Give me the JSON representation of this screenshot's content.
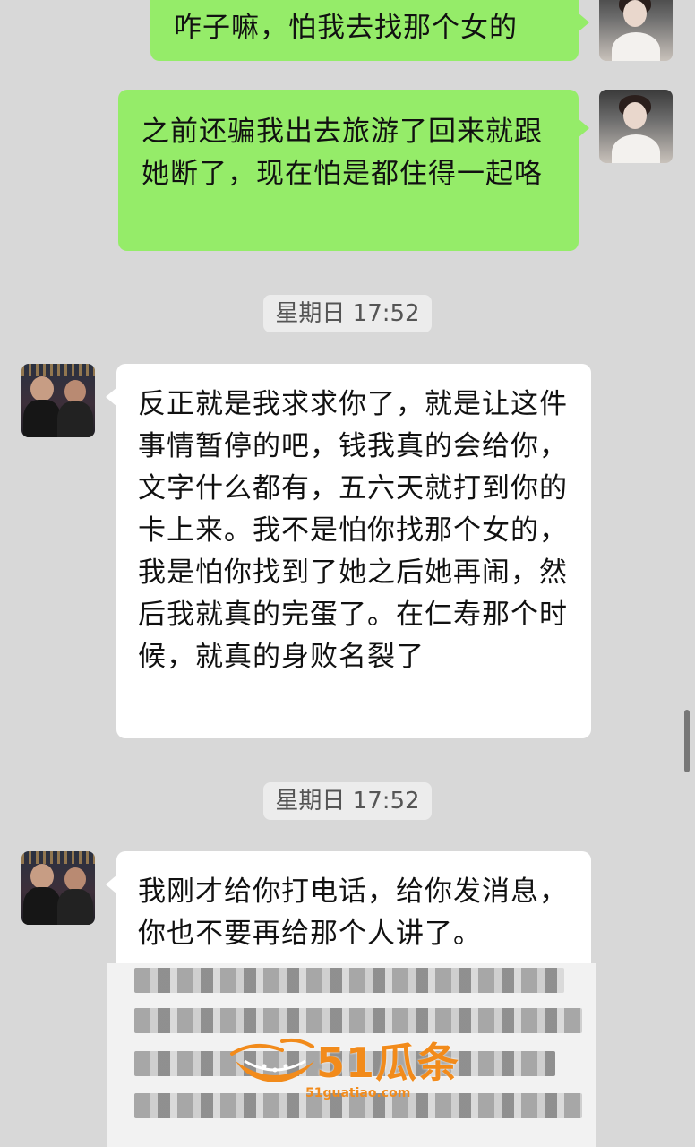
{
  "messages": [
    {
      "side": "out",
      "text": "咋子嘛，怕我去找那个女的"
    },
    {
      "side": "out",
      "text": "之前还骗我出去旅游了回来就跟她断了，现在怕是都住得一起咯"
    },
    {
      "type": "time",
      "text": "星期日 17:52"
    },
    {
      "side": "in",
      "text": "反正就是我求求你了，就是让这件事情暂停的吧，钱我真的会给你，文字什么都有，五六天就打到你的卡上来。我不是怕你找那个女的，我是怕你找到了她之后她再闹，然后我就真的完蛋了。在仁寿那个时候，就真的身败名裂了"
    },
    {
      "type": "time",
      "text": "星期日 17:52"
    },
    {
      "side": "in",
      "text": "我刚才给你打电话，给你发消息，你也不要再给那个人讲了。"
    }
  ],
  "watermark": {
    "main": "51瓜条",
    "sub": "51guatiao.com"
  },
  "colors": {
    "out_bubble": "#95ec69",
    "in_bubble": "#ffffff",
    "background": "#d8d8d8",
    "watermark": "#f28b1b"
  }
}
